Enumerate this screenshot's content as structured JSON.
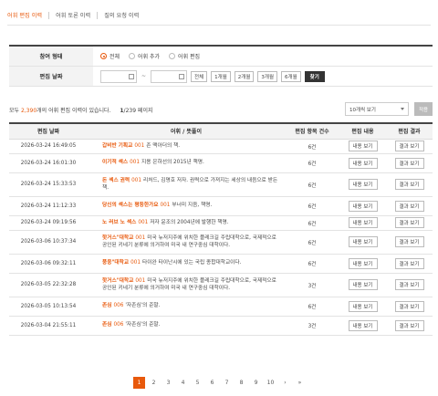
{
  "tabs": [
    {
      "label": "어휘 편집 이력",
      "active": true
    },
    {
      "label": "어휘 토론 이력",
      "active": false
    },
    {
      "label": "질의 요청 이력",
      "active": false
    }
  ],
  "filter": {
    "type_label": "참여 형태",
    "type_options": [
      {
        "label": "전체",
        "selected": true
      },
      {
        "label": "어휘 추가",
        "selected": false
      },
      {
        "label": "어휘 편집",
        "selected": false
      }
    ],
    "date_label": "편집 날짜",
    "date_sep": "~",
    "periods": [
      "전체",
      "1개월",
      "2개월",
      "3개월",
      "6개월"
    ],
    "search_label": "찾기"
  },
  "summary": {
    "prefix": "모두 ",
    "total": "2,390",
    "suffix": "개의 어휘 편집 이력이 있습니다.",
    "page": "1",
    "pages_suffix": "/239 페이지"
  },
  "page_size_select": "10개씩 보기",
  "apply_label": "적용",
  "table": {
    "headers": [
      "편집 날짜",
      "어휘 / 뜻풀이",
      "편집 항목 건수",
      "편집 내용",
      "편집 결과"
    ],
    "rows": [
      {
        "date": "2026-03-24 16:49:05",
        "word": "갑비반 기획교",
        "no": "001",
        "def": "존 맥아더의 책.",
        "count": "6건"
      },
      {
        "date": "2026-03-24 16:01:30",
        "word": "이기적 섹스",
        "no": "001",
        "def": "지용 은하선의 2015년 책명.",
        "count": "6건"
      },
      {
        "date": "2026-03-24 15:33:53",
        "word": "돈 섹스 권력",
        "no": "001",
        "def": "리처드, 김명호 저자. 권력으로 가져지는 세상의 내음으로 받든 책.",
        "count": "6건"
      },
      {
        "date": "2026-03-24 11:12:33",
        "word": "당신의 섹스는 평등한가요",
        "no": "001",
        "def": "부너미 지음, 책명.",
        "count": "6건"
      },
      {
        "date": "2026-03-24 09:19:56",
        "word": "노 러브 노 섹스",
        "no": "001",
        "def": "저자 윤조의 2004년에 발행한 책명.",
        "count": "6건"
      },
      {
        "date": "2026-03-06 10:37:34",
        "word": "핫거스\"대학교",
        "no": "001",
        "def": "미국 뉴저지주에 위치한 플레크길 주립대학으로, 국제적으로 공인된 키네기 분류에 의거하여 미국 내 연구중심 대학이다.",
        "count": "6건"
      },
      {
        "date": "2026-03-06 09:32:11",
        "word": "풍웅\"대학교",
        "no": "001",
        "def": "타이완 타이난시에 있는 국립 종합대학교이다.",
        "count": "6건"
      },
      {
        "date": "2026-03-05 22:32:28",
        "word": "핫거스\"대학교",
        "no": "001",
        "def": "미국 뉴저지주에 위치한 플레크길 주립대학으로, 국제적으로 공인된 키네기 분류에 의거하여 미국 내 연구중심 대학이다.",
        "count": "3건"
      },
      {
        "date": "2026-03-05 10:13:54",
        "word": "존심",
        "no": "006",
        "def": "'자존심'의 준말.",
        "count": "6건"
      },
      {
        "date": "2026-03-04 21:55:11",
        "word": "존심",
        "no": "006",
        "def": "'자존심'의 준말.",
        "count": "3건"
      }
    ],
    "view_content": "내용 보기",
    "view_result": "결과 보기"
  },
  "pagination": {
    "pages": [
      "1",
      "2",
      "3",
      "4",
      "5",
      "6",
      "7",
      "8",
      "9",
      "10"
    ],
    "current": "1",
    "next": "›",
    "last": "»"
  },
  "colors": {
    "accent": "#e8590c",
    "header_bg": "#f3f3f3"
  }
}
